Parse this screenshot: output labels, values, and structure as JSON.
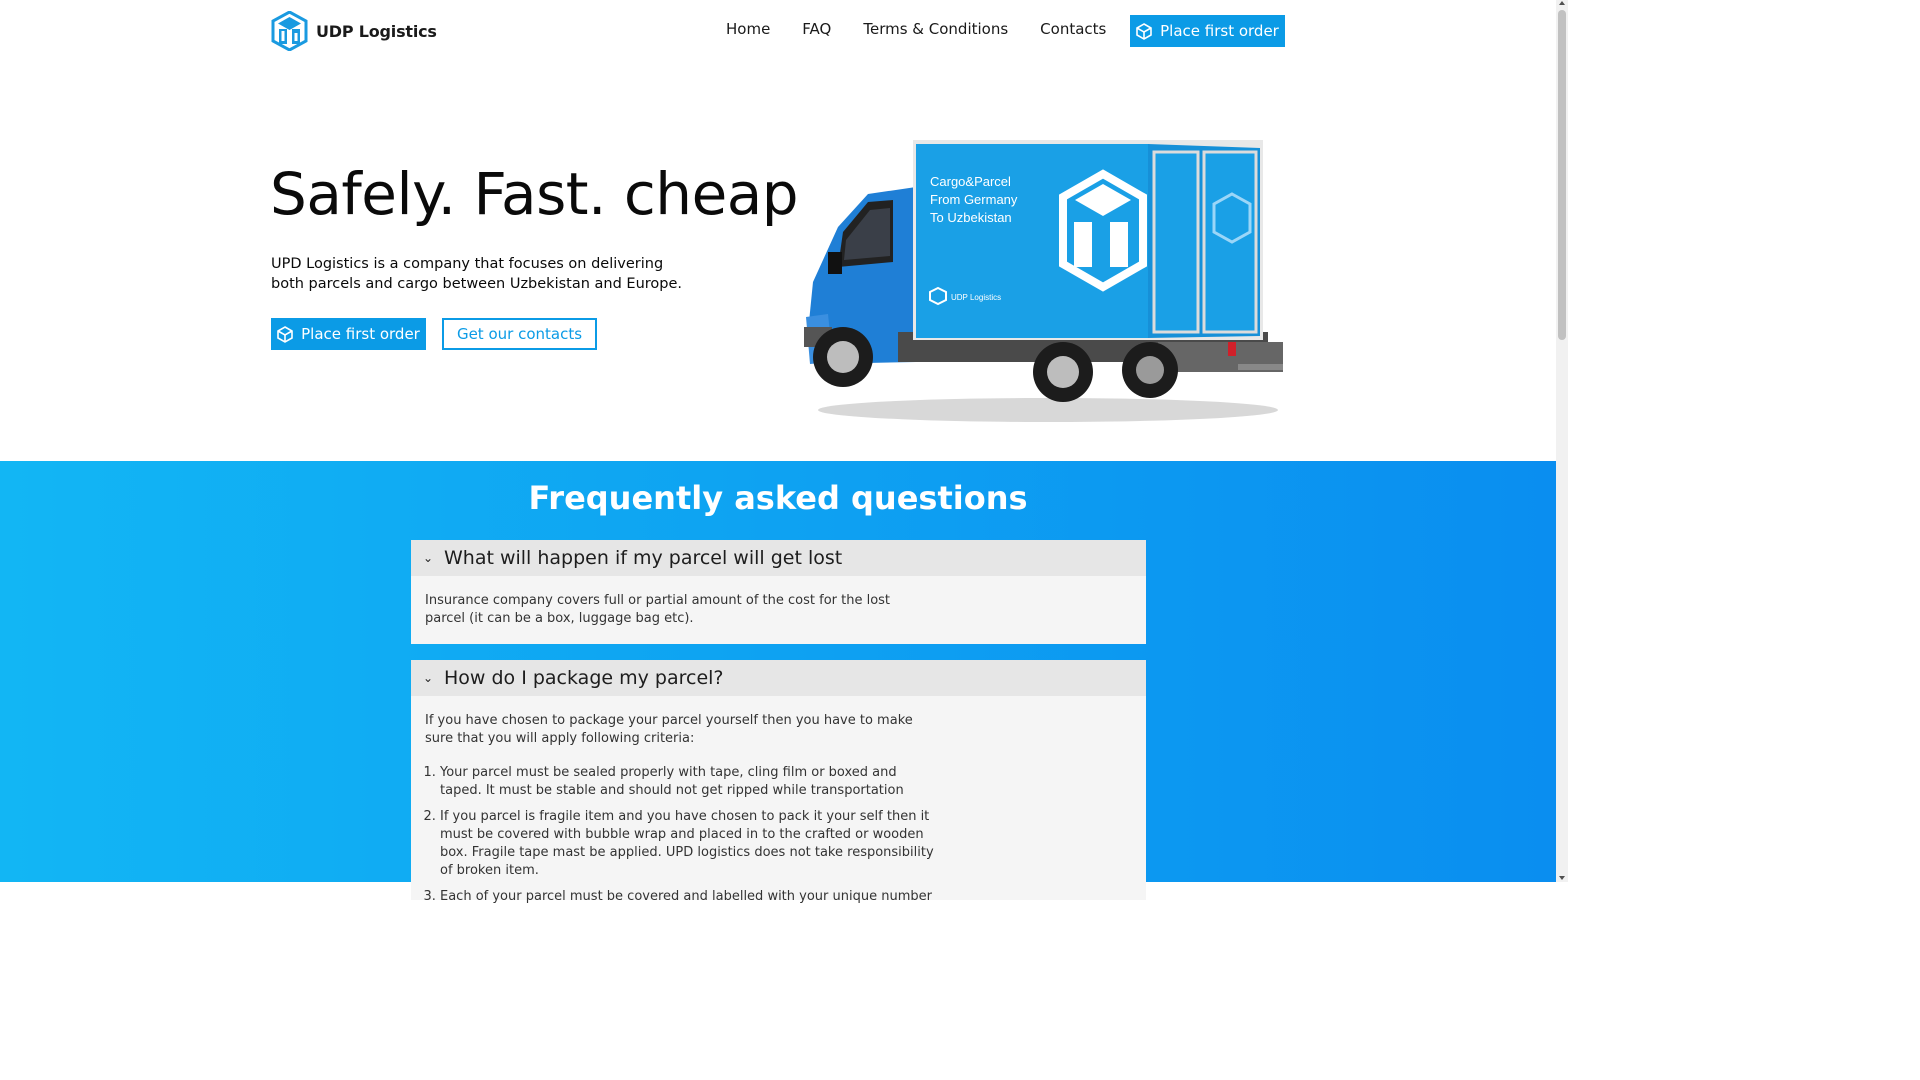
{
  "brand": {
    "name": "UDP Logistics",
    "accent": "#0b9be6"
  },
  "nav": {
    "home": "Home",
    "faq": "FAQ",
    "terms": "Terms & Conditions",
    "contacts": "Contacts",
    "cta": "Place first order"
  },
  "hero": {
    "title": "Safely. Fast. cheap",
    "description": "UPD Logistics is a company that focuses on delivering both parcels and cargo between Uzbekistan and Europe.",
    "primary_button": "Place first order",
    "secondary_button": "Get our contacts",
    "truck_text_line1": "Cargo&Parcel",
    "truck_text_line2": "From Germany",
    "truck_text_line3": "To Uzbekistan",
    "truck_brand": "UDP Logistics"
  },
  "faq": {
    "title": "Frequently asked questions",
    "items": [
      {
        "question": "What will happen if my parcel will get lost",
        "answer": "Insurance company covers full or partial amount of the cost for the lost parcel (it can be a box, luggage bag etc)."
      },
      {
        "question": "How do I package my parcel?",
        "answer": "If you have chosen to package your parcel yourself then you have to make sure that you will apply following criteria:",
        "list": [
          "Your parcel must be sealed properly with tape, cling film or boxed and taped. It must be stable and should not get ripped while transportation",
          "If you parcel is fragile item and you have chosen to pack it your self then it must be covered with bubble wrap and placed in to the crafted or wooden box. Fragile tape mast be applied. UPD logistics does not take responsibility of broken item.",
          "Each of your parcel must be covered and labelled with your unique number"
        ]
      }
    ]
  }
}
